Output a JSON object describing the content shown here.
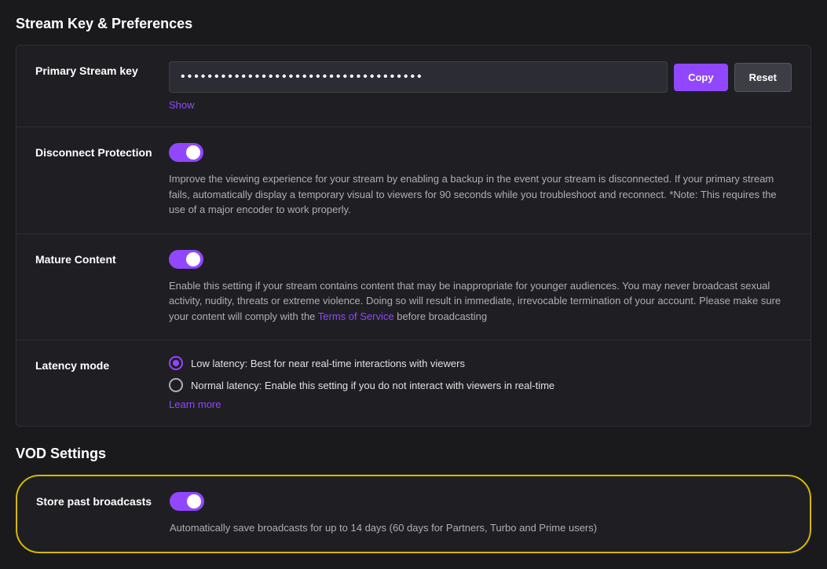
{
  "page": {
    "title": "Stream Key & Preferences",
    "vod_section_title": "VOD Settings"
  },
  "stream_key": {
    "label": "Primary Stream key",
    "value": "••••••••••••••••••••••••••••••••••••",
    "copy_button": "Copy",
    "reset_button": "Reset",
    "show_link": "Show"
  },
  "disconnect_protection": {
    "label": "Disconnect Protection",
    "enabled": true,
    "description": "Improve the viewing experience for your stream by enabling a backup in the event your stream is disconnected. If your primary stream fails, automatically display a temporary visual to viewers for 90 seconds while you troubleshoot and reconnect. *Note: This requires the use of a major encoder to work properly."
  },
  "mature_content": {
    "label": "Mature Content",
    "enabled": true,
    "description_before": "Enable this setting if your stream contains content that may be inappropriate for younger audiences. You may never broadcast sexual activity, nudity, threats or extreme violence. Doing so will result in immediate, irrevocable termination of your account. Please make sure your content will comply with the ",
    "terms_link": "Terms of Service",
    "description_after": " before broadcasting"
  },
  "latency_mode": {
    "label": "Latency mode",
    "options": [
      {
        "id": "low",
        "label": "Low latency: Best for near real-time interactions with viewers",
        "selected": true
      },
      {
        "id": "normal",
        "label": "Normal latency: Enable this setting if you do not interact with viewers in real-time",
        "selected": false
      }
    ],
    "learn_more": "Learn more"
  },
  "store_past_broadcasts": {
    "label": "Store past broadcasts",
    "enabled": true,
    "description": "Automatically save broadcasts for up to 14 days (60 days for Partners, Turbo and Prime users)"
  }
}
